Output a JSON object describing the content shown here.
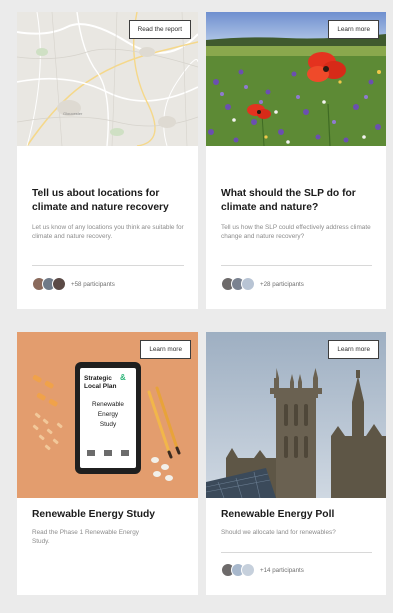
{
  "cards": [
    {
      "button_label": "Read the report",
      "title": "Tell us about locations for climate and nature recovery",
      "description": "Let us know of any locations you think are suitable for climate and nature recovery.",
      "participants": "+58 participants",
      "map_label": "Gloucester"
    },
    {
      "button_label": "Learn more",
      "title": "What should the SLP do for climate and nature?",
      "description": "Tell us how the SLP could effectively address climate change and nature recovery?",
      "participants": "+28 participants"
    },
    {
      "button_label": "Learn more",
      "title": "Renewable Energy Study",
      "description": "Read the Phase 1 Renewable Energy Study.",
      "tablet": {
        "logo_line1": "Strategic",
        "logo_amp": "&",
        "logo_line2": "Local Plan",
        "study_line1": "Renewable",
        "study_line2": "Energy",
        "study_line3": "Study"
      }
    },
    {
      "button_label": "Learn more",
      "title": "Renewable Energy Poll",
      "description": "Should we allocate land for renewables?",
      "participants": "+14 participants"
    }
  ],
  "colors": {
    "page_bg": "#ebebeb",
    "card_bg": "#ffffff",
    "title": "#1b1b1b",
    "muted": "#8c8c8c",
    "button_border": "#3d3d3d",
    "logo_green": "#2fb57a"
  }
}
